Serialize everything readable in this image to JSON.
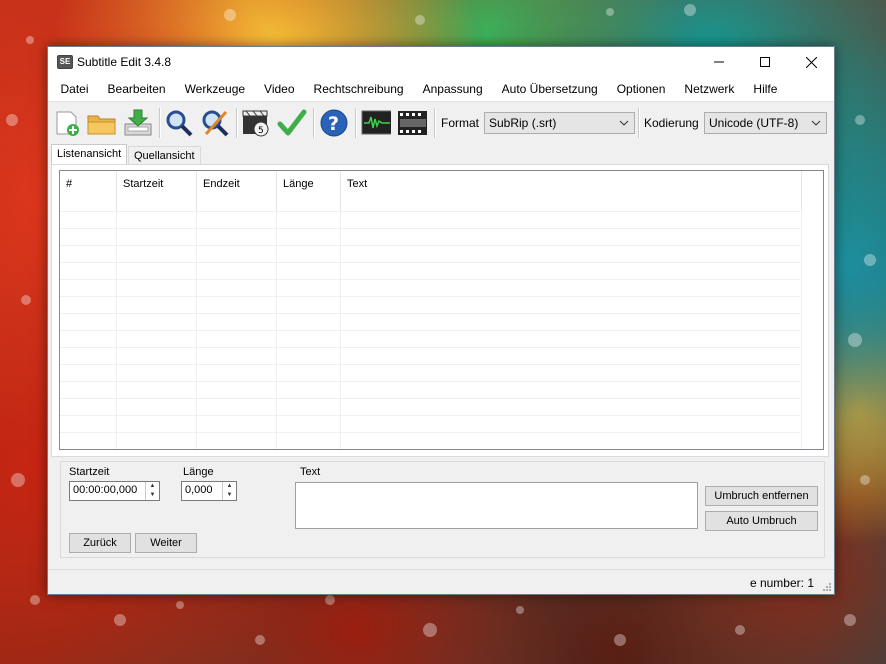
{
  "window": {
    "title": "Subtitle Edit 3.4.8",
    "app_icon_text": "SE"
  },
  "menu": [
    "Datei",
    "Bearbeiten",
    "Werkzeuge",
    "Video",
    "Rechtschreibung",
    "Anpassung",
    "Auto Übersetzung",
    "Optionen",
    "Netzwerk",
    "Hilfe"
  ],
  "toolbar": {
    "icons": [
      "new-file-icon",
      "open-folder-icon",
      "save-download-icon",
      "find-icon",
      "replace-icon",
      "visual-sync-icon",
      "spell-check-icon",
      "help-icon",
      "waveform-icon",
      "video-icon"
    ],
    "format_label": "Format",
    "format_value": "SubRip (.srt)",
    "encoding_label": "Kodierung",
    "encoding_value": "Unicode (UTF-8)"
  },
  "tabs": [
    "Listenansicht",
    "Quellansicht"
  ],
  "grid": {
    "columns": [
      "#",
      "Startzeit",
      "Endzeit",
      "Länge",
      "Text"
    ]
  },
  "editor": {
    "start_label": "Startzeit",
    "start_value": "00:00:00,000",
    "duration_label": "Länge",
    "duration_value": "0,000",
    "text_label": "Text",
    "remove_break_button": "Umbruch entfernen",
    "auto_break_button": "Auto Umbruch",
    "prev_button": "Zurück",
    "next_button": "Weiter"
  },
  "status": {
    "text": "e number: 1"
  },
  "colors": {
    "accent_green": "#3fae49",
    "help_blue": "#2a62b8",
    "window_bg": "#f0f0f0"
  }
}
